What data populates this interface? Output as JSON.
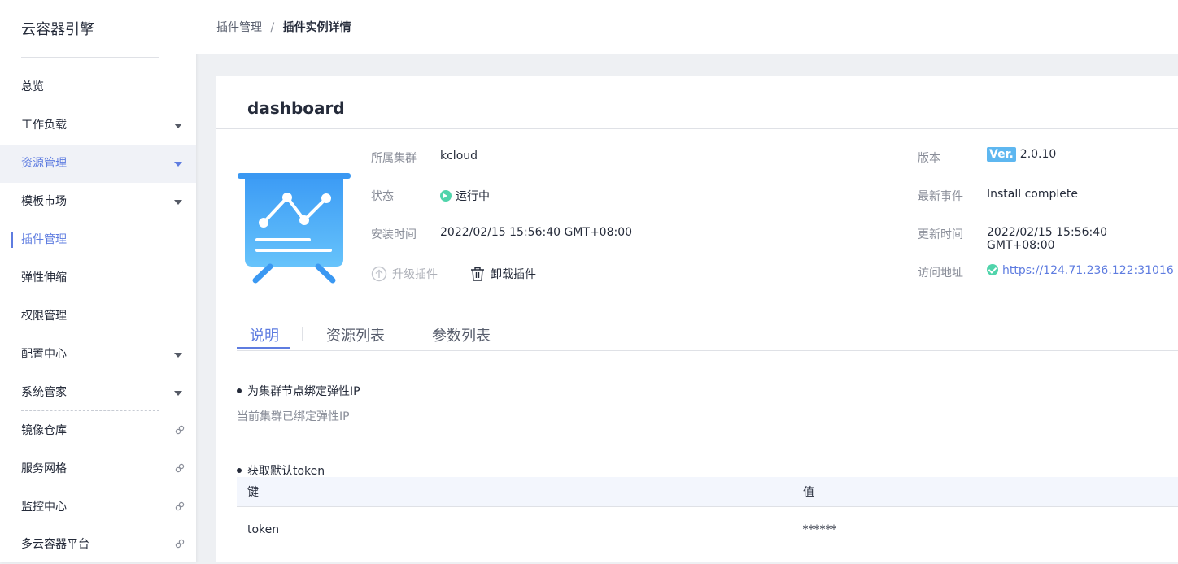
{
  "app": {
    "title": "云容器引擎"
  },
  "sidebar": {
    "items": [
      {
        "label": "总览"
      },
      {
        "label": "工作负载"
      },
      {
        "label": "资源管理"
      },
      {
        "label": "模板市场"
      },
      {
        "label": "插件管理"
      },
      {
        "label": "弹性伸缩"
      },
      {
        "label": "权限管理"
      },
      {
        "label": "配置中心"
      },
      {
        "label": "系统管家"
      },
      {
        "label": "镜像仓库"
      },
      {
        "label": "服务网格"
      },
      {
        "label": "监控中心"
      },
      {
        "label": "多云容器平台"
      }
    ]
  },
  "breadcrumb": {
    "parent": "插件管理",
    "separator": "/",
    "current": "插件实例详情"
  },
  "plugin": {
    "name": "dashboard",
    "fields": {
      "cluster_label": "所属集群",
      "cluster_value": "kcloud",
      "status_label": "状态",
      "status_value": "运行中",
      "install_time_label": "安装时间",
      "install_time_value": "2022/02/15 15:56:40 GMT+08:00",
      "version_label": "版本",
      "version_badge": "Ver.",
      "version_value": "2.0.10",
      "event_label": "最新事件",
      "event_value": "Install complete",
      "update_time_label": "更新时间",
      "update_time_value": "2022/02/15 15:56:40 GMT+08:00",
      "url_label": "访问地址",
      "url_value": "https://124.71.236.122:31016"
    },
    "actions": {
      "upgrade": "升级插件",
      "uninstall": "卸载插件"
    }
  },
  "tabs": [
    {
      "label": "说明"
    },
    {
      "label": "资源列表"
    },
    {
      "label": "参数列表"
    }
  ],
  "content": {
    "section1_title": "为集群节点绑定弹性IP",
    "section1_desc": "当前集群已绑定弹性IP",
    "section2_title": "获取默认token",
    "table": {
      "headers": {
        "key": "键",
        "value": "值"
      },
      "rows": [
        {
          "key": "token",
          "value": "******"
        }
      ]
    }
  },
  "colors": {
    "accent": "#5e7ce0",
    "success": "#50d4ab",
    "version_badge": "#5eb7f0"
  }
}
